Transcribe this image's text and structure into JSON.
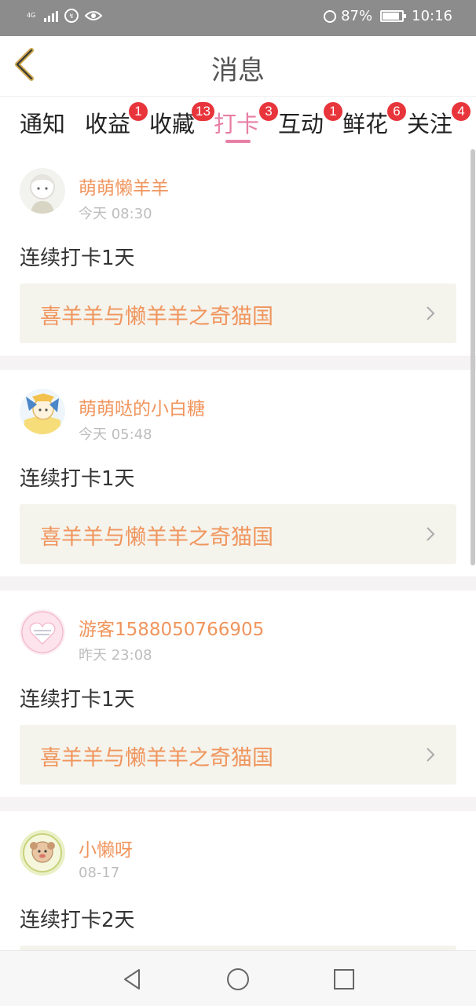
{
  "status_bar": {
    "network": "4G",
    "battery": "87%",
    "battery_level": 0.87,
    "time": "10:16"
  },
  "header": {
    "title": "消息",
    "back_icon": "back-chevron-icon"
  },
  "tabs": [
    {
      "label": "通知",
      "badge": ""
    },
    {
      "label": "收益",
      "badge": "1"
    },
    {
      "label": "收藏",
      "badge": "13"
    },
    {
      "label": "打卡",
      "badge": "3",
      "active": true
    },
    {
      "label": "互动",
      "badge": "1"
    },
    {
      "label": "鲜花",
      "badge": "6"
    },
    {
      "label": "关注",
      "badge": "4"
    }
  ],
  "feed": [
    {
      "name": "萌萌懒羊羊",
      "time": "今天 08:30",
      "text": "连续打卡1天",
      "book": "喜羊羊与懒羊羊之奇猫国"
    },
    {
      "name": "萌萌哒的小白糖",
      "time": "今天 05:48",
      "text": "连续打卡1天",
      "book": "喜羊羊与懒羊羊之奇猫国"
    },
    {
      "name": "游客1588050766905",
      "time": "昨天 23:08",
      "text": "连续打卡1天",
      "book": "喜羊羊与懒羊羊之奇猫国"
    },
    {
      "name": "小懒呀",
      "time": "08-17",
      "text": "连续打卡2天",
      "book": ""
    }
  ],
  "colors": {
    "accent_pink": "#e77fa5",
    "orange_text": "#f0955d",
    "badge_red": "#e8343b",
    "book_bg": "#f4f3ec"
  },
  "nav": [
    "back-triangle-icon",
    "home-circle-icon",
    "recents-square-icon"
  ]
}
